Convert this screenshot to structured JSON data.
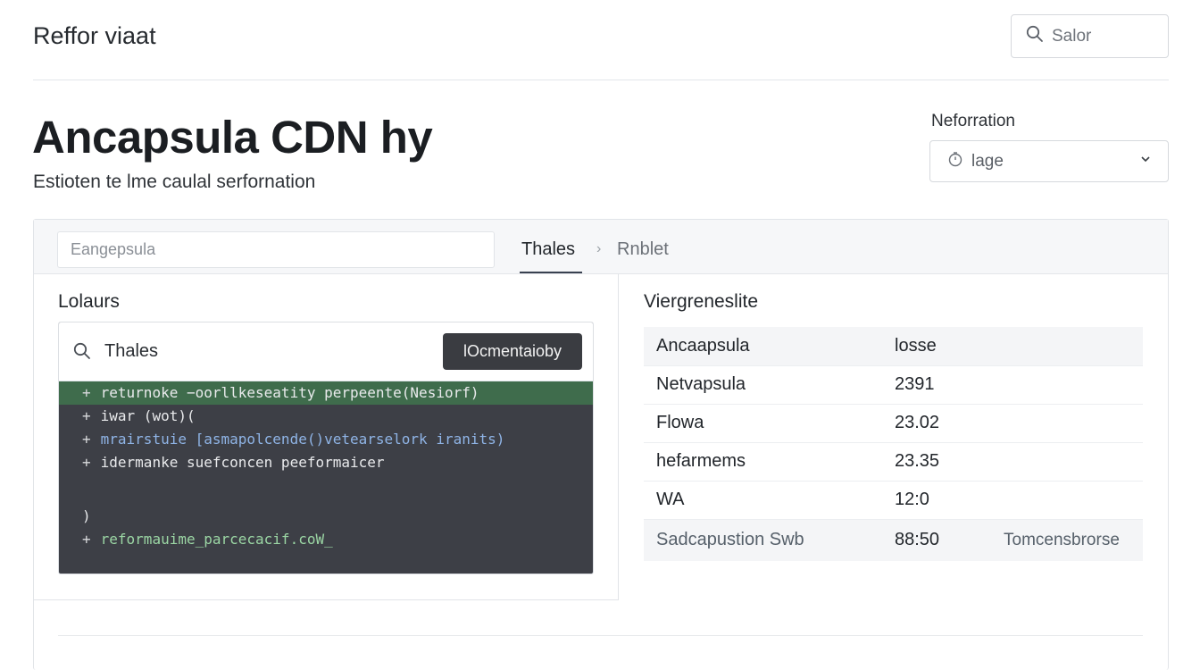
{
  "header": {
    "app_title": "Reffor viaat",
    "search_placeholder": "Salor"
  },
  "page": {
    "title": "Ancapsula CDN hy",
    "subtitle": "Estioten te lme caulal serfornation"
  },
  "performance": {
    "label": "Neforration",
    "selected": "lage"
  },
  "card": {
    "search_placeholder": "Eangepsula",
    "tabs": [
      {
        "label": "Thales",
        "active": true
      },
      {
        "label": "Rnblet",
        "active": false
      }
    ]
  },
  "left_panel": {
    "title": "Lolaurs",
    "code_header_label": "Thales",
    "button_label": "lOcmentaioby",
    "lines": [
      {
        "prefix": "+",
        "text": "returnoke −oorllkeseatity perpeente(Nesiorf)",
        "highlight": true
      },
      {
        "prefix": "+",
        "text": "iwar (wot)(",
        "highlight": false
      },
      {
        "prefix": "+",
        "text": "mrairstuie [asmapolcende()vetearselork iranits)",
        "highlight": false
      },
      {
        "prefix": "+",
        "text": "idermanke suefconcen peeformaicer",
        "highlight": false
      },
      {
        "prefix": "",
        "text": "",
        "highlight": false
      },
      {
        "prefix": "",
        "text": ")",
        "highlight": false
      },
      {
        "prefix": "+",
        "text": "reformauime_parcecacif.coW_",
        "highlight": false
      }
    ]
  },
  "right_panel": {
    "title": "Viergreneslite",
    "rows": [
      {
        "name": "Ancaapsula",
        "value": "losse",
        "extra": ""
      },
      {
        "name": "Netvapsula",
        "value": "2391",
        "extra": ""
      },
      {
        "name": "Flowa",
        "value": "23.02",
        "extra": ""
      },
      {
        "name": "hefarmems",
        "value": "23.35",
        "extra": ""
      },
      {
        "name": "WA",
        "value": "12:0",
        "extra": ""
      },
      {
        "name": "Sadcapustion Swb",
        "value": "88:50",
        "extra": "Tomcensbrorse"
      }
    ]
  }
}
